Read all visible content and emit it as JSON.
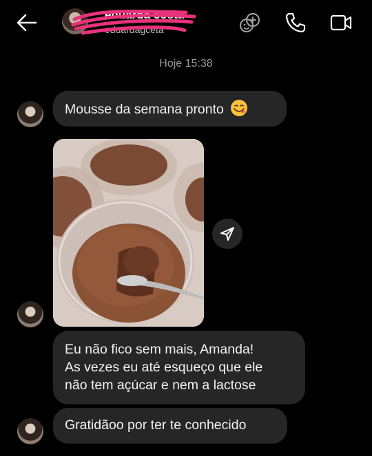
{
  "header": {
    "username": "eduarda costa",
    "handle": "eduardagceta"
  },
  "conversation": {
    "timestamp": "Hoje 15:38"
  },
  "messages": [
    {
      "text": "Mousse da semana pronto",
      "emoji": "yum-face-emoji"
    },
    {
      "lines": [
        "Eu não fico sem mais, Amanda!",
        "As vezes eu até esqueço que ele",
        "não tem açúcar e nem a lactose"
      ]
    },
    {
      "text": "Gratidãoo por ter te conhecido"
    }
  ],
  "icons": {
    "back": "arrow-left-icon",
    "effects": "effects-icon",
    "call": "phone-icon",
    "video": "video-camera-icon",
    "share": "send-icon"
  },
  "colors": {
    "background": "#000000",
    "bubble": "#262626",
    "scribble": "#e8327a"
  }
}
